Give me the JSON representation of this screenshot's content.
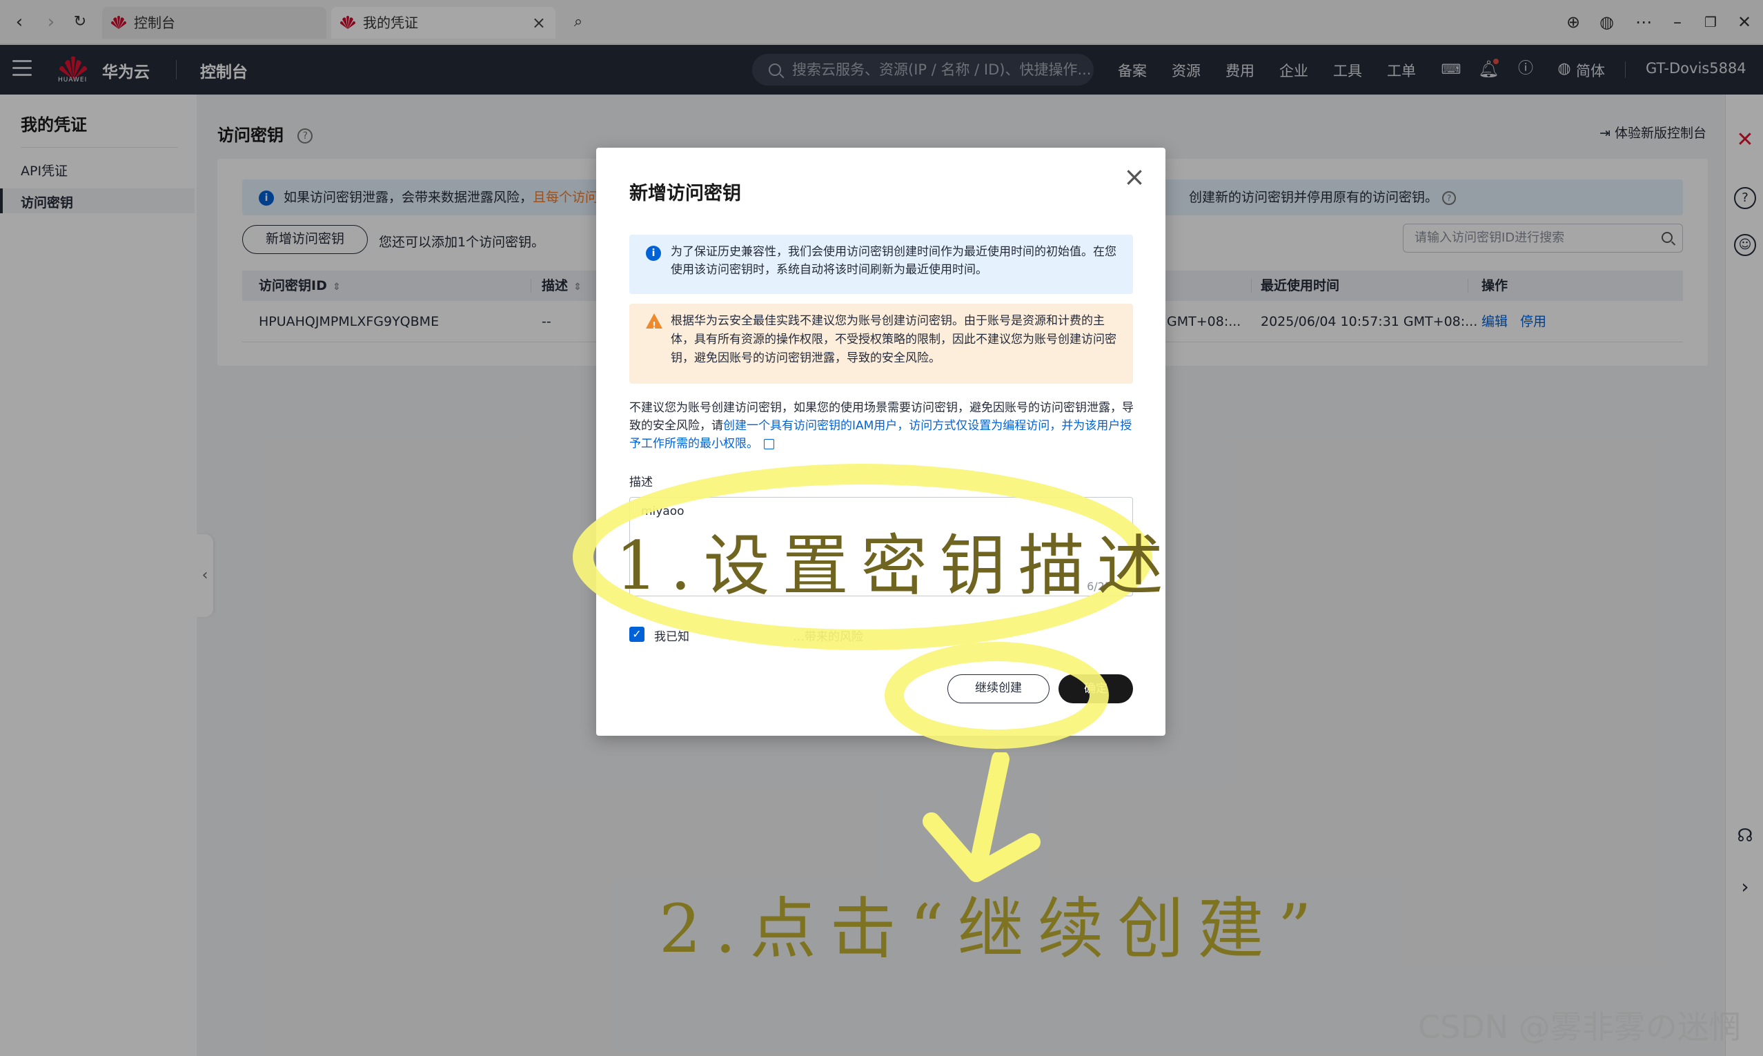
{
  "browser": {
    "tabs": [
      {
        "label": "控制台"
      },
      {
        "label": "我的凭证"
      }
    ]
  },
  "topnav": {
    "logo_text": "HUAWEI",
    "brand": "华为云",
    "console": "控制台",
    "search_placeholder": "搜索云服务、资源(IP / 名称 / ID)、快捷操作...",
    "items": [
      "备案",
      "资源",
      "费用",
      "企业",
      "工具",
      "工单"
    ],
    "lang": "简体",
    "user": "GT-Dovis5884"
  },
  "sidebar": {
    "title": "我的凭证",
    "items": [
      {
        "label": "API凭证"
      },
      {
        "label": "访问密钥"
      }
    ]
  },
  "main": {
    "title": "访问密钥",
    "new_console": "体验新版控制台",
    "info_text": "如果访问密钥泄露，会带来数据泄露风险，",
    "info_orange": "且每个访问密",
    "info_right": "创建新的访问密钥并停用原有的访问密钥。",
    "add_button": "新增访问密钥",
    "quota_text": "您还可以添加1个访问密钥。",
    "search_placeholder": "请输入访问密钥ID进行搜索",
    "columns": [
      "访问密钥ID",
      "描述",
      "最近使用时间",
      "操作"
    ],
    "row": {
      "id": "HPUAHQJMPMLXFG9YQBME",
      "desc": "--",
      "created": "GMT+08:...",
      "last_used": "2025/06/04 10:57:31 GMT+08:...",
      "edit": "编辑",
      "disable": "停用"
    }
  },
  "modal": {
    "title": "新增访问密钥",
    "info": "为了保证历史兼容性，我们会使用访问密钥创建时间作为最近使用时间的初始值。在您使用该访问密钥时，系统自动将该时间刷新为最近使用时间。",
    "warning": "根据华为云安全最佳实践不建议您为账号创建访问密钥。由于账号是资源和计费的主体，具有所有资源的操作权限，不受授权策略的限制，因此不建议您为账号创建访问密钥，避免因账号的访问密钥泄露，导致的安全风险。",
    "para_prefix": "不建议您为账号创建访问密钥，如果您的使用场景需要访问密钥，避免因账号的访问密钥泄露，导致的安全风险，请",
    "para_link": "创建一个具有访问密钥的IAM用户，访问方式仅设置为编程访问，并为该用户授予工作所需的最小权限。",
    "desc_label": "描述",
    "desc_value": "miyaoo",
    "count": "6/25",
    "checkbox_text": "我已知",
    "checkbox_text_tail": "…带来的风险",
    "continue_button": "继续创建",
    "confirm_button": "确定"
  },
  "annotations": {
    "step1": "1.设置密钥描述",
    "step2": "2.点击“继续创建”"
  },
  "watermark": "CSDN @雾非雾の迷惘",
  "colors": {
    "nav_bg": "#252b3a",
    "link": "#0062d6",
    "highlight": "#f8f578",
    "warning_bg": "#fdeedc",
    "info_bg": "#e5f1fd"
  }
}
